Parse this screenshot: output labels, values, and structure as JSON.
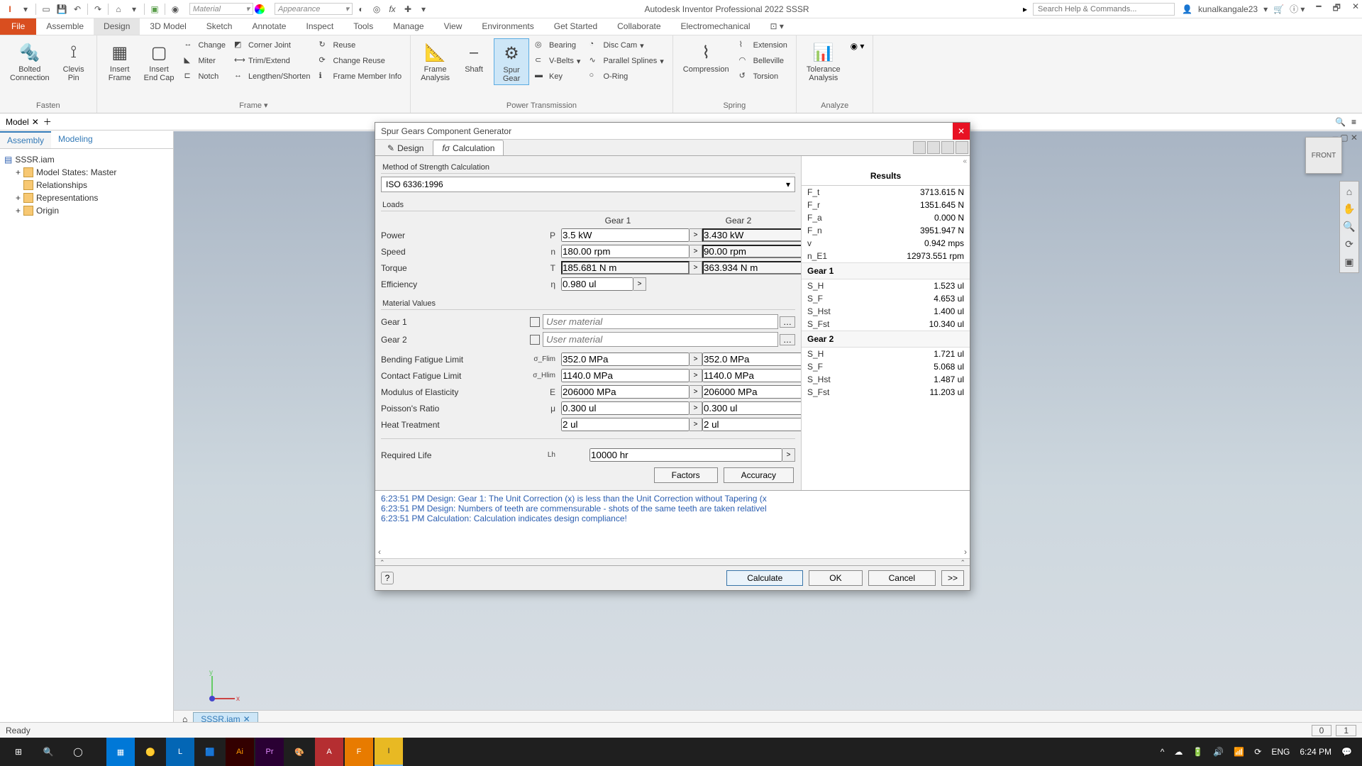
{
  "app_title": "Autodesk Inventor Professional 2022   SSSR",
  "search_placeholder": "Search Help & Commands...",
  "user": "kunalkangale23",
  "material_dd": "Material",
  "appearance_dd": "Appearance",
  "file_tab": "File",
  "main_tabs": [
    "Assemble",
    "Design",
    "3D Model",
    "Sketch",
    "Annotate",
    "Inspect",
    "Tools",
    "Manage",
    "View",
    "Environments",
    "Get Started",
    "Collaborate",
    "Electromechanical"
  ],
  "active_main_tab": 1,
  "ribbon": {
    "fasten": {
      "label": "Fasten",
      "bolted": "Bolted\nConnection",
      "clevis": "Clevis\nPin"
    },
    "frame": {
      "label": "Frame ▾",
      "insert_frame": "Insert\nFrame",
      "insert_endcap": "Insert\nEnd Cap",
      "items": [
        "Change",
        "Corner Joint",
        "Reuse",
        "Miter",
        "Trim/Extend",
        "Change Reuse",
        "Notch",
        "Lengthen/Shorten",
        "Frame Member Info"
      ]
    },
    "power": {
      "label": "Power Transmission",
      "frame_analysis": "Frame\nAnalysis",
      "shaft": "Shaft",
      "spur": "Spur\nGear",
      "bearing": "Bearing",
      "vbelts": "V-Belts",
      "key": "Key",
      "disccam": "Disc Cam",
      "psplines": "Parallel Splines",
      "oring": "O-Ring"
    },
    "spring": {
      "label": "Spring",
      "compression": "Compression",
      "extension": "Extension",
      "belleville": "Belleville",
      "torsion": "Torsion"
    },
    "analyze": {
      "label": "Analyze",
      "tol": "Tolerance\nAnalysis"
    }
  },
  "browser": {
    "model_tab": "Model",
    "tabs": [
      "Assembly",
      "Modeling"
    ],
    "root": "SSSR.iam",
    "items": [
      "Model States: Master",
      "Relationships",
      "Representations",
      "Origin"
    ]
  },
  "view": {
    "front": "FRONT",
    "doc_tab": "SSSR.iam"
  },
  "dialog": {
    "title": "Spur Gears Component Generator",
    "tab_design": "Design",
    "tab_calc": "Calculation",
    "method_label": "Method of Strength Calculation",
    "method_value": "ISO 6336:1996",
    "loads_label": "Loads",
    "gear1": "Gear 1",
    "gear2": "Gear 2",
    "rows": {
      "power": {
        "label": "Power",
        "sym": "P",
        "g1": "3.5 kW",
        "g2": "3.430 kW"
      },
      "speed": {
        "label": "Speed",
        "sym": "n",
        "g1": "180.00 rpm",
        "g2": "90.00 rpm"
      },
      "torque": {
        "label": "Torque",
        "sym": "T",
        "g1": "185.681 N m",
        "g2": "363.934 N m"
      },
      "eff": {
        "label": "Efficiency",
        "sym": "η",
        "v": "0.980 ul"
      }
    },
    "matvals_label": "Material Values",
    "mat_ph": "User material",
    "bending": {
      "label": "Bending Fatigue Limit",
      "sym": "σ_Flim",
      "g1": "352.0 MPa",
      "g2": "352.0 MPa"
    },
    "contact": {
      "label": "Contact Fatigue Limit",
      "sym": "σ_Hlim",
      "g1": "1140.0 MPa",
      "g2": "1140.0 MPa"
    },
    "modulus": {
      "label": "Modulus of Elasticity",
      "sym": "E",
      "g1": "206000 MPa",
      "g2": "206000 MPa"
    },
    "poisson": {
      "label": "Poisson's Ratio",
      "sym": "μ",
      "g1": "0.300 ul",
      "g2": "0.300 ul"
    },
    "heat": {
      "label": "Heat Treatment",
      "sym": "",
      "g1": "2 ul",
      "g2": "2 ul"
    },
    "reqlife": {
      "label": "Required Life",
      "sym": "Lh",
      "v": "10000 hr"
    },
    "factors_btn": "Factors",
    "accuracy_btn": "Accuracy",
    "log": [
      "6:23:51 PM Design: Gear 1: The Unit Correction (x) is less than the Unit Correction without Tapering (x",
      "6:23:51 PM Design: Numbers of teeth are commensurable - shots of the same teeth are taken relativel",
      "6:23:51 PM Calculation: Calculation indicates design compliance!"
    ],
    "results": {
      "title": "Results",
      "forces": [
        {
          "l": "F_t",
          "v": "3713.615 N"
        },
        {
          "l": "F_r",
          "v": "1351.645 N"
        },
        {
          "l": "F_a",
          "v": "0.000 N"
        },
        {
          "l": "F_n",
          "v": "3951.947 N"
        },
        {
          "l": "v",
          "v": "0.942 mps"
        },
        {
          "l": "n_E1",
          "v": "12973.551 rpm"
        }
      ],
      "g1_title": "Gear 1",
      "g1": [
        {
          "l": "S_H",
          "v": "1.523 ul"
        },
        {
          "l": "S_F",
          "v": "4.653 ul"
        },
        {
          "l": "S_Hst",
          "v": "1.400 ul"
        },
        {
          "l": "S_Fst",
          "v": "10.340 ul"
        }
      ],
      "g2_title": "Gear 2",
      "g2": [
        {
          "l": "S_H",
          "v": "1.721 ul"
        },
        {
          "l": "S_F",
          "v": "5.068 ul"
        },
        {
          "l": "S_Hst",
          "v": "1.487 ul"
        },
        {
          "l": "S_Fst",
          "v": "11.203 ul"
        }
      ]
    },
    "calc_btn": "Calculate",
    "ok_btn": "OK",
    "cancel_btn": "Cancel",
    "more_btn": ">>"
  },
  "status": {
    "ready": "Ready",
    "n1": "0",
    "n2": "1"
  },
  "taskbar": {
    "lang": "ENG",
    "time": "6:24 PM"
  }
}
